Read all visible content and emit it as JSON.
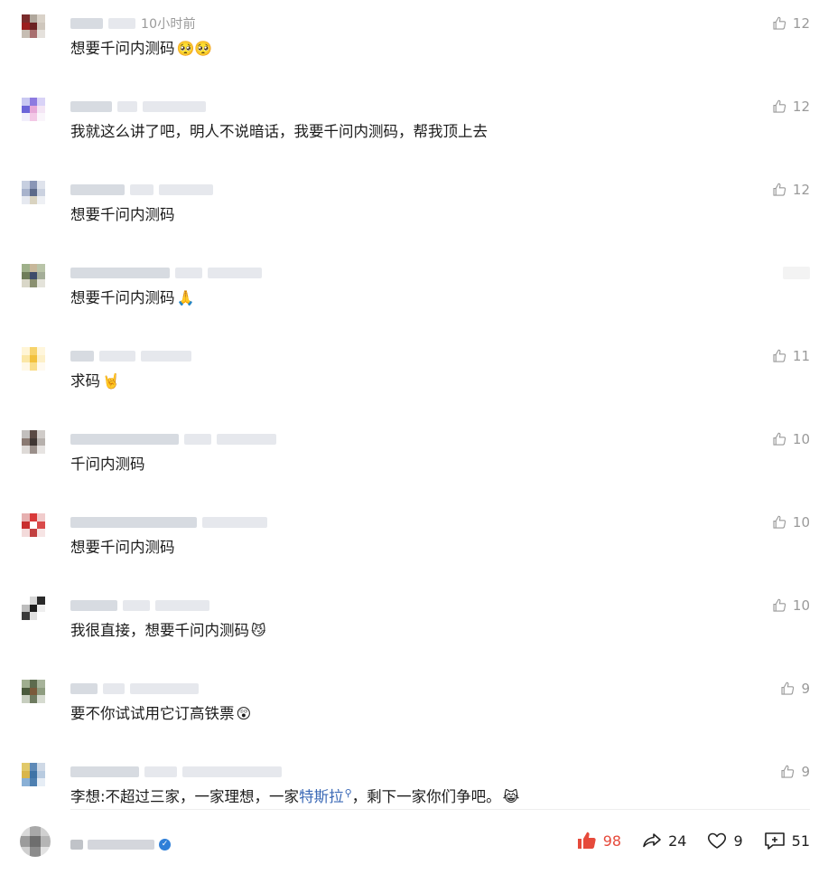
{
  "comments": [
    {
      "time": "10小时前",
      "text": "想要千问内测码",
      "emoji": "🥺🥺",
      "likes": "12"
    },
    {
      "text": "我就这么讲了吧，明人不说暗话，我要千问内测码，帮我顶上去",
      "likes": "12"
    },
    {
      "text": "想要千问内测码",
      "likes": "12"
    },
    {
      "text": "想要千问内测码",
      "emoji": "🙏",
      "likes": ""
    },
    {
      "text": "求码",
      "emoji": "🤘",
      "likes": "11"
    },
    {
      "text": "千问内测码",
      "likes": "10"
    },
    {
      "text": "想要千问内测码",
      "likes": "10"
    },
    {
      "text": "我很直接，想要千问内测码",
      "emoji": "😼",
      "likes": "10"
    },
    {
      "text": "要不你试试用它订高铁票",
      "emoji": "😲",
      "likes": "9"
    },
    {
      "text_before": "李想:不超过三家，一家理想，一家",
      "link": "特斯拉",
      "text_after": "，剩下一家你们争吧。",
      "emoji": "😹",
      "likes": "9"
    }
  ],
  "footer": {
    "like_count": "98",
    "share_count": "24",
    "favorite_count": "9",
    "comment_count": "51",
    "verified_mark": "✓"
  },
  "colors": {
    "like_active": "#e64a3b",
    "link": "#3b69b6",
    "meta": "#9a9a9a"
  },
  "icons": {
    "like": "thumb-up-icon",
    "share": "share-arrow-icon",
    "favorite": "heart-icon",
    "comment": "comment-plus-icon"
  }
}
